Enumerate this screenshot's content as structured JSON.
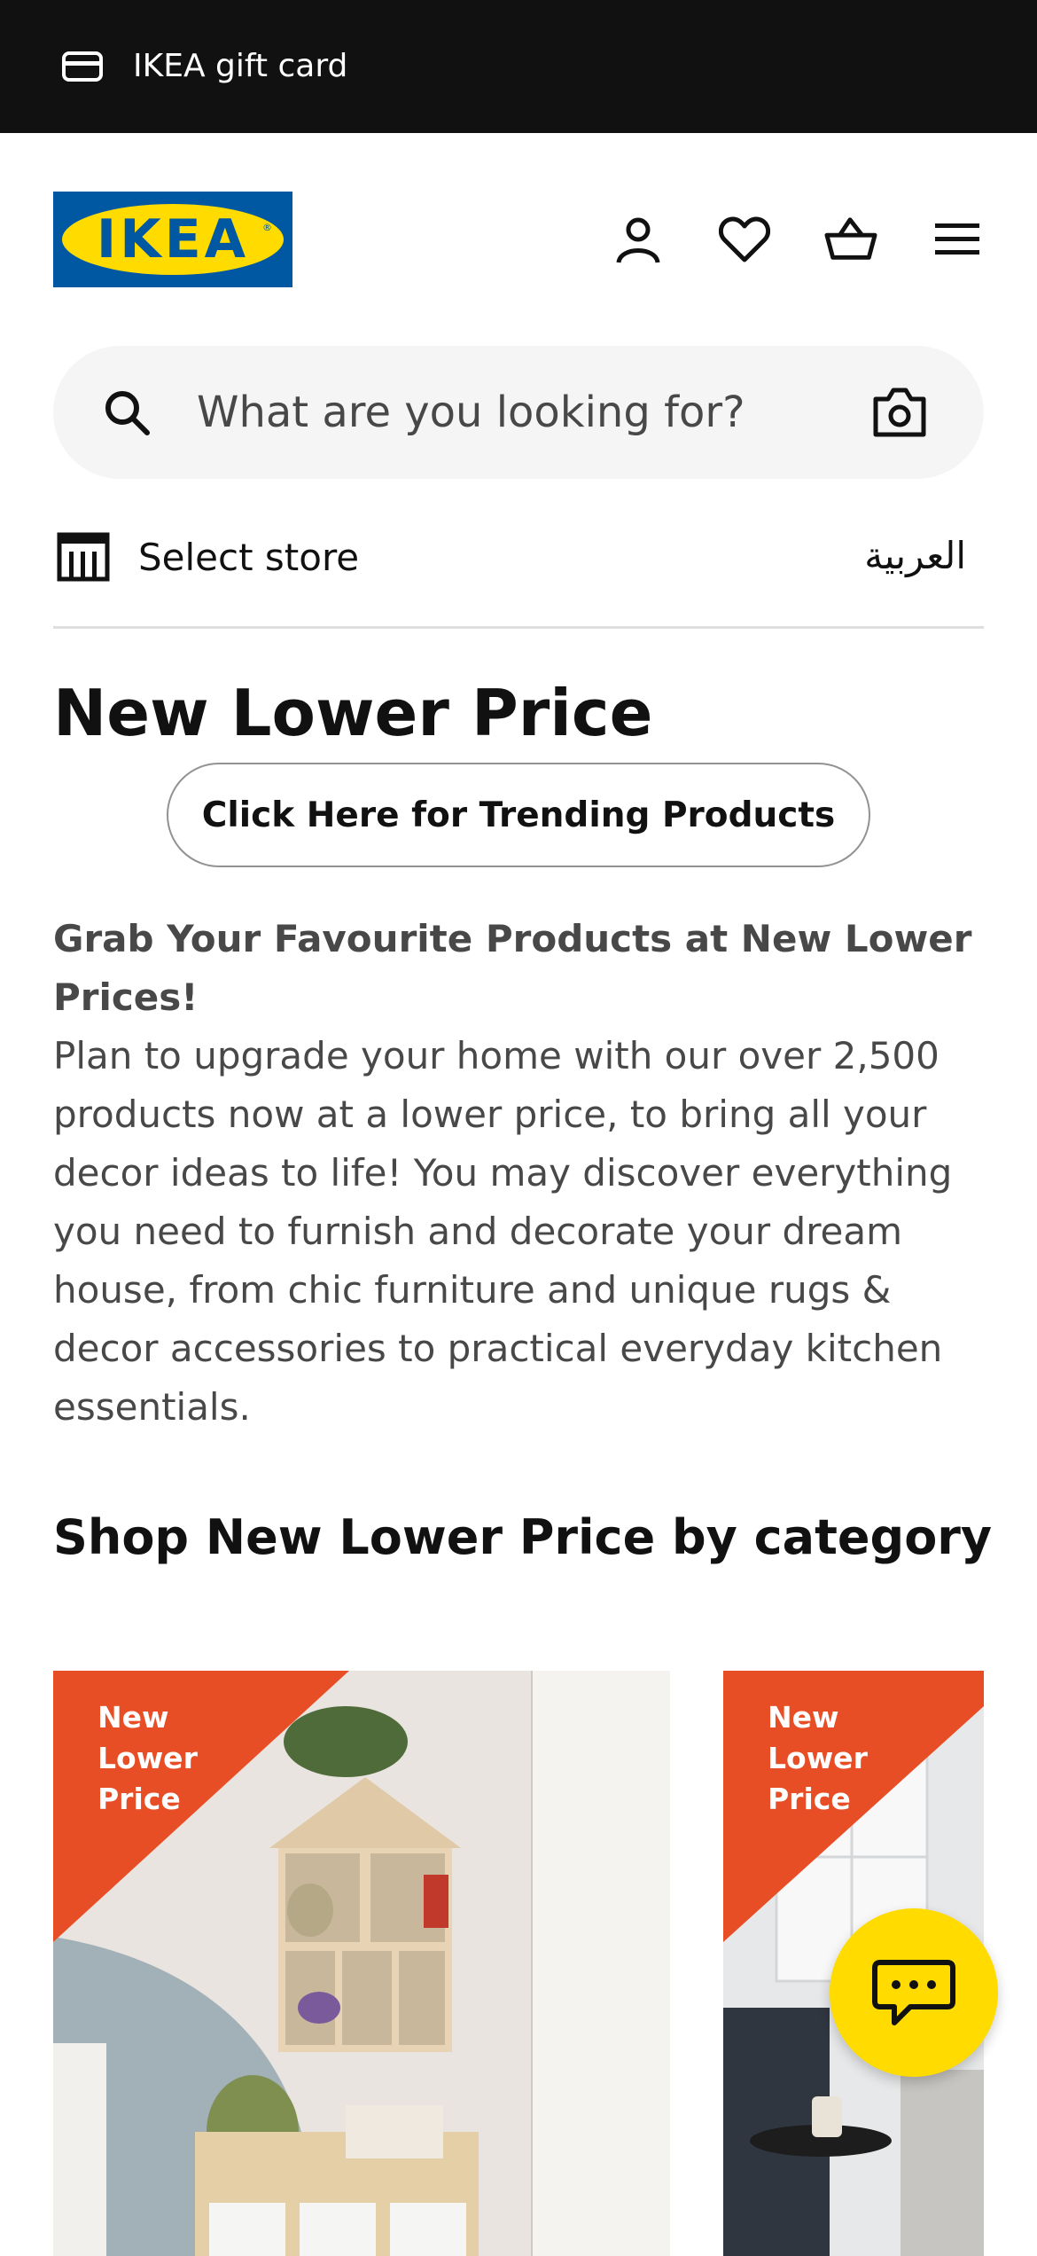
{
  "topbar": {
    "gift_card_label": "IKEA gift card",
    "icon": "credit-card-icon"
  },
  "header": {
    "logo_text": "IKEA",
    "logo_reg": "®",
    "colors": {
      "logo_blue": "#0058a3",
      "logo_yellow": "#ffdb00"
    },
    "icons": [
      "profile-icon",
      "heart-icon",
      "basket-icon",
      "menu-icon"
    ]
  },
  "search": {
    "placeholder": "What are you looking for?",
    "icons": [
      "search-icon",
      "camera-icon"
    ]
  },
  "store": {
    "label": "Select store",
    "language": "العربية",
    "icon": "store-icon"
  },
  "main": {
    "title": "New Lower Price",
    "cta_label": "Click Here for Trending Products",
    "lead": "Grab Your Favourite Products at New Lower Prices!",
    "body": "Plan to upgrade your home with our over 2,500 products now at a lower price, to bring all your decor ideas to life! You may discover everything you need to furnish and decorate your dream house, from chic furniture and unique rugs & decor accessories to practical everyday kitchen essentials."
  },
  "section": {
    "title": "Shop New Lower Price by category",
    "cards": [
      {
        "badge": "New\nLower\nPrice"
      },
      {
        "badge": "New\nLower\nPrice"
      }
    ],
    "badge_color": "#e84e26"
  },
  "chat": {
    "icon": "chat-icon",
    "color": "#fcd844"
  }
}
